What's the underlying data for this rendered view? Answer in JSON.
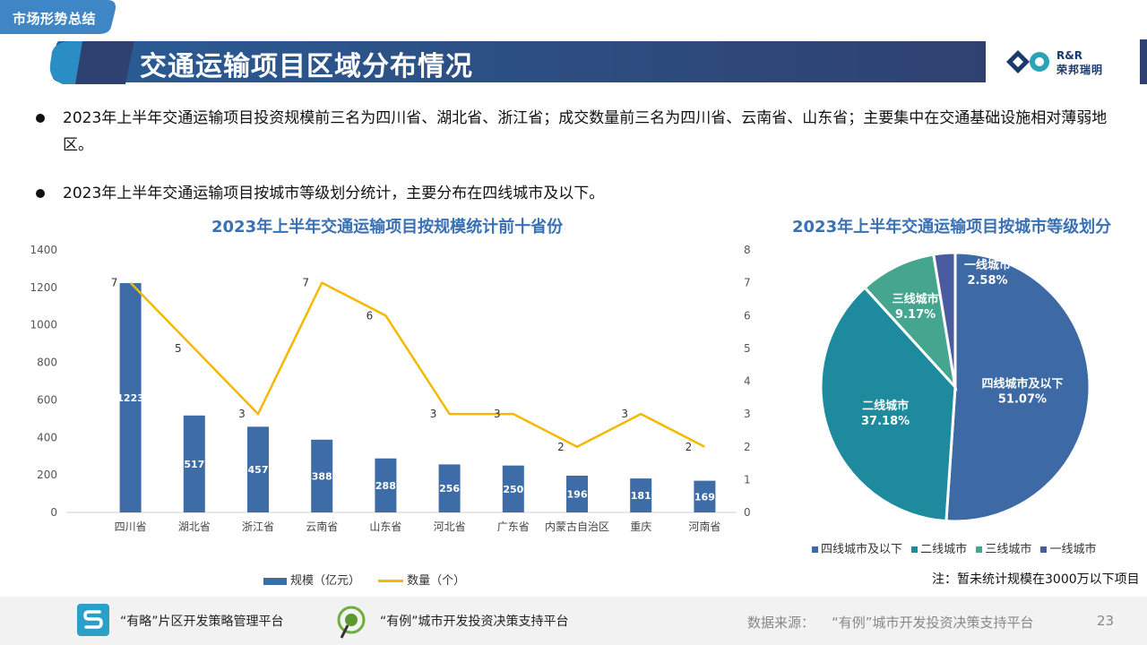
{
  "header": {
    "section_tag": "市场形势总结",
    "title": "交通运输项目区域分布情况",
    "logo_brand": "R&R",
    "logo_name": "荣邦瑞明"
  },
  "bullets": [
    "2023年上半年交通运输项目投资规模前三名为四川省、湖北省、浙江省；成交数量前三名为四川省、云南省、山东省；主要集中在交通基础设施相对薄弱地区。",
    "2023年上半年交通运输项目按城市等级划分统计，主要分布在四线城市及以下。"
  ],
  "colors": {
    "title_bar": "#2c4675",
    "accent_blue": "#3e6ca7",
    "line_yellow": "#f5b800",
    "pie_tier4": "#3d6aa5",
    "pie_tier2": "#1e8a9e",
    "pie_tier3": "#45a58e",
    "pie_tier1": "#4a5ba0"
  },
  "chart_data": [
    {
      "type": "bar",
      "title": "2023年上半年交通运输项目按规模统计前十省份",
      "categories": [
        "四川省",
        "湖北省",
        "浙江省",
        "云南省",
        "山东省",
        "河北省",
        "广东省",
        "内蒙古自治区",
        "重庆",
        "河南省"
      ],
      "series": [
        {
          "name": "规模（亿元）",
          "type": "bar",
          "axis": "left",
          "values": [
            1223,
            517,
            457,
            388,
            288,
            256,
            250,
            196,
            181,
            169
          ]
        },
        {
          "name": "数量（个）",
          "type": "line",
          "axis": "right",
          "values": [
            7,
            5,
            3,
            7,
            6,
            3,
            3,
            2,
            3,
            2
          ]
        }
      ],
      "ylim": [
        0,
        1400
      ],
      "yticks": [
        0,
        200,
        400,
        600,
        800,
        1000,
        1200,
        1400
      ],
      "y2lim": [
        0,
        8
      ],
      "y2ticks": [
        0,
        1,
        2,
        3,
        4,
        5,
        6,
        7,
        8
      ],
      "legend": "bottom"
    },
    {
      "type": "pie",
      "title": "2023年上半年交通运输项目按城市等级划分",
      "slices": [
        {
          "label": "四线城市及以下",
          "value": 51.07,
          "value_text": "51.07%"
        },
        {
          "label": "二线城市",
          "value": 37.18,
          "value_text": "37.18%"
        },
        {
          "label": "三线城市",
          "value": 9.17,
          "value_text": "9.17%"
        },
        {
          "label": "一线城市",
          "value": 2.58,
          "value_text": "2.58%"
        }
      ],
      "legend": "bottom"
    }
  ],
  "note": "注：暂未统计规模在3000万以下项目",
  "footer": {
    "platform1": "“有略”片区开发策略管理平台",
    "platform2": "“有例”城市开发投资决策支持平台",
    "source_label": "数据来源：",
    "source": "“有例”城市开发投资决策支持平台",
    "page": "23"
  }
}
